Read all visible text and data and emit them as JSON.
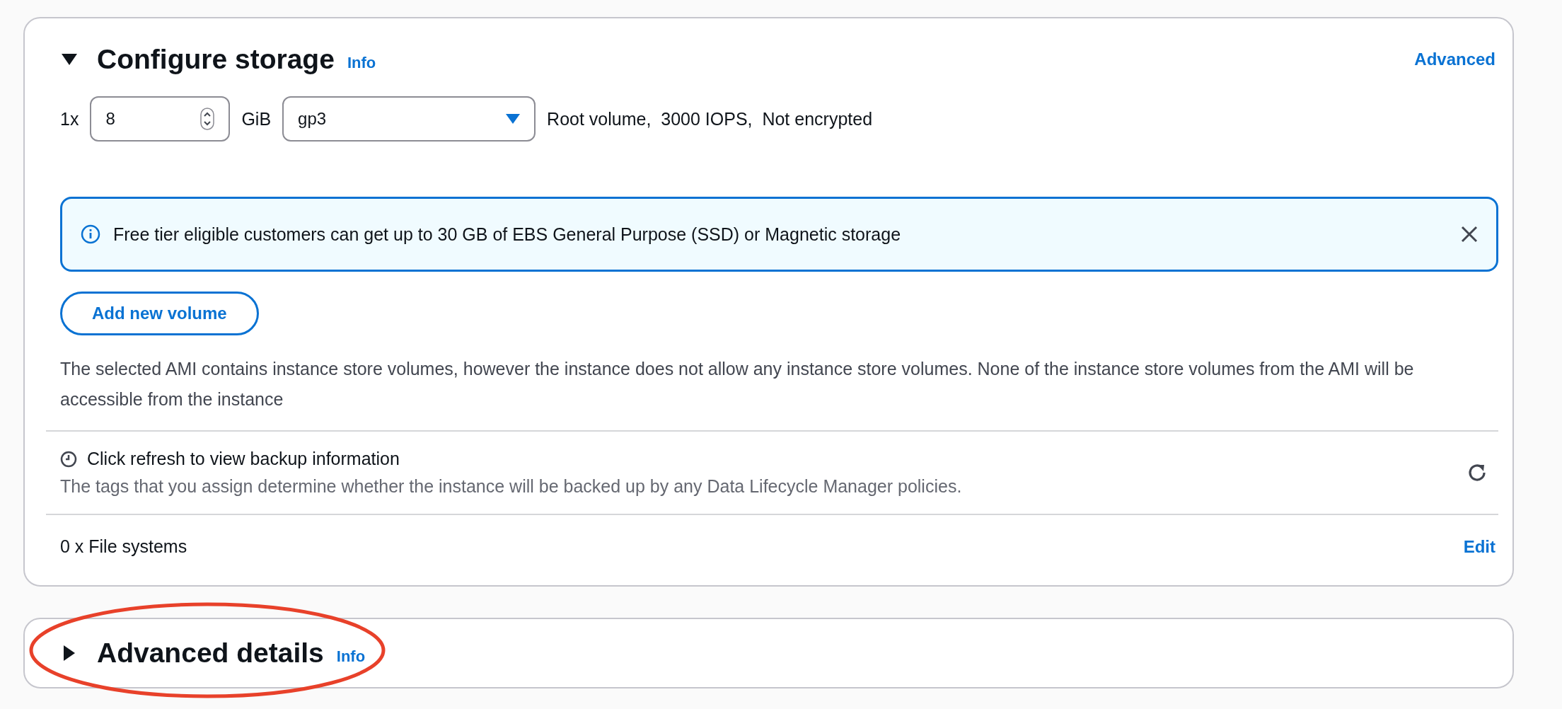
{
  "storage": {
    "title": "Configure storage",
    "expanded": true,
    "info": "Info",
    "advanced": "Advanced",
    "volume": {
      "count": "1x",
      "size": "8",
      "unit": "GiB",
      "type": "gp3",
      "summary": "Root volume,  3000 IOPS,  Not encrypted"
    },
    "alert": {
      "text": "Free tier eligible customers can get up to 30 GB of EBS General Purpose (SSD) or Magnetic storage"
    },
    "add_button": "Add new volume",
    "note": "The selected AMI contains instance store volumes, however the instance does not allow any instance store volumes. None of the instance store volumes from the AMI will be accessible from the instance",
    "backup": {
      "title": "Click refresh to view backup information",
      "description": "The tags that you assign determine whether the instance will be backed up by any Data Lifecycle Manager policies."
    },
    "file_systems": {
      "label": "0 x File systems",
      "action": "Edit"
    }
  },
  "advanced_details": {
    "title": "Advanced details",
    "expanded": false,
    "info": "Info"
  }
}
